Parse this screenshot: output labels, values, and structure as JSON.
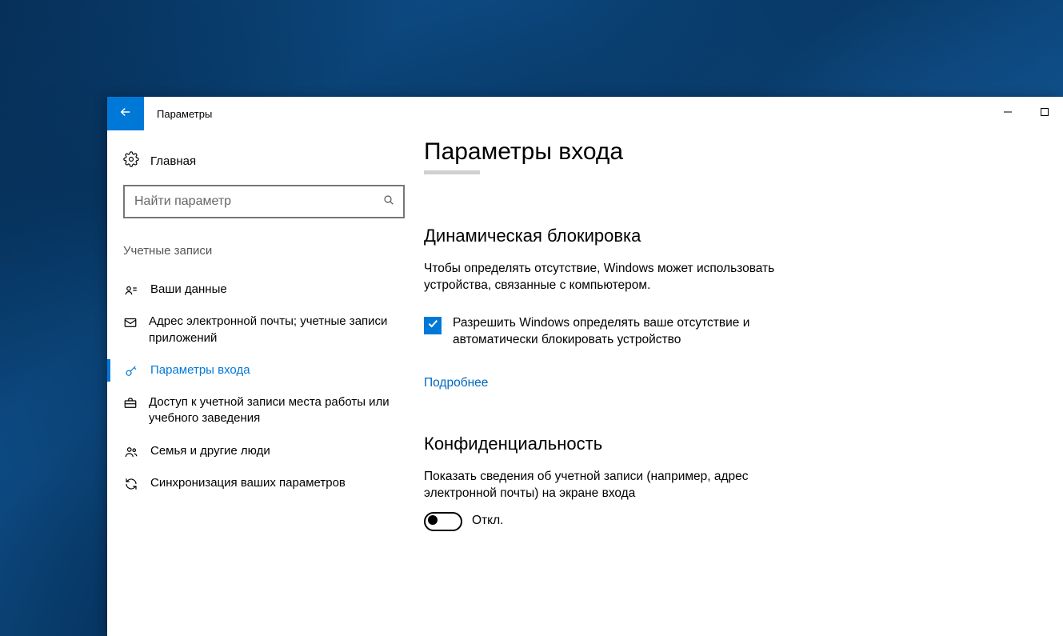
{
  "window": {
    "title": "Параметры"
  },
  "sidebar": {
    "home": "Главная",
    "search_placeholder": "Найти параметр",
    "group": "Учетные записи",
    "items": [
      {
        "label": "Ваши данные"
      },
      {
        "label": "Адрес электронной почты; учетные записи приложений"
      },
      {
        "label": "Параметры входа"
      },
      {
        "label": "Доступ к учетной записи места работы или учебного заведения"
      },
      {
        "label": "Семья и другие люди"
      },
      {
        "label": "Синхронизация ваших параметров"
      }
    ]
  },
  "content": {
    "page_title": "Параметры входа",
    "dynamic_lock": {
      "heading": "Динамическая блокировка",
      "description": "Чтобы определять отсутствие, Windows может использовать устройства, связанные с компьютером.",
      "checkbox_label": "Разрешить Windows определять ваше отсутствие и автоматически блокировать устройство",
      "checkbox_checked": true,
      "learn_more": "Подробнее"
    },
    "privacy": {
      "heading": "Конфиденциальность",
      "description": "Показать сведения об учетной записи (например, адрес электронной почты) на экране входа",
      "toggle_state": "Откл."
    }
  }
}
